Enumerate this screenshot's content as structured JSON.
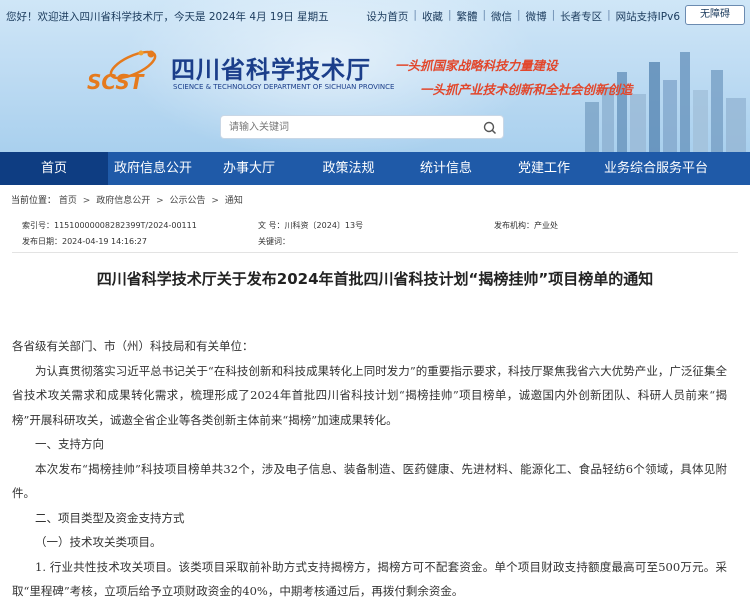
{
  "topbar": {
    "welcome": "您好！欢迎进入四川省科学技术厅，今天是  2024年 4月 19日  星期五",
    "links": [
      "设为首页",
      "收藏",
      "繁體",
      "微信",
      "微博",
      "长者专区",
      "网站支持IPv6"
    ],
    "accessible_button": "无障碍"
  },
  "logo": {
    "abbr": "SCST",
    "cn_name": "四川省科学技术厅",
    "en_name": "SCIENCE & TECHNOLOGY DEPARTMENT OF SICHUAN PROVINCE"
  },
  "slogans": [
    "一头抓国家战略科技力量建设",
    "一头抓产业技术创新和全社会创新创造"
  ],
  "search": {
    "placeholder": "请输入关键词"
  },
  "nav": {
    "items": [
      "首页",
      "政府信息公开",
      "办事大厅",
      "政策法规",
      "统计信息",
      "党建工作",
      "业务综合服务平台"
    ],
    "active_index": 0
  },
  "breadcrumb": {
    "label": "当前位置：",
    "items": [
      "首页",
      "政府信息公开",
      "公示公告",
      "通知"
    ]
  },
  "meta": {
    "index_label": "索引号：",
    "index_value": "11510000008282399T/2024-00111",
    "doc_label": "文    号：",
    "doc_value": "川科资〔2024〕13号",
    "issuer_label": "发布机构：",
    "issuer_value": "产业处",
    "date_label": "发布日期：",
    "date_value": "2024-04-19 14:16:27",
    "keywords_label": "关键词：",
    "keywords_value": ""
  },
  "article": {
    "title": "四川省科学技术厅关于发布2024年首批四川省科技计划“揭榜挂帅”项目榜单的通知",
    "salutation": "各省级有关部门、市（州）科技局和有关单位：",
    "para1": "为认真贯彻落实习近平总书记关于“在科技创新和科技成果转化上同时发力”的重要指示要求，科技厅聚焦我省六大优势产业，广泛征集全省技术攻关需求和成果转化需求，梳理形成了2024年首批四川省科技计划“揭榜挂帅”项目榜单，诚邀国内外创新团队、科研人员前来“揭榜”开展科研攻关，诚邀全省企业等各类创新主体前来“揭榜”加速成果转化。",
    "h1": "一、支持方向",
    "para2": "本次发布“揭榜挂帅”科技项目榜单共32个，涉及电子信息、装备制造、医药健康、先进材料、能源化工、食品轻纺6个领域，具体见附件。",
    "h2": "二、项目类型及资金支持方式",
    "sub1": "（一）技术攻关类项目。",
    "para3": "1. 行业共性技术攻关项目。该类项目采取前补助方式支持揭榜方，揭榜方可不配套资金。单个项目财政支持额度最高可至500万元。采取“里程碑”考核，立项后给予立项财政资金的40%，中期考核通过后，再拨付剩余资金。"
  },
  "colors": {
    "nav_bg": "#1f5aa8",
    "nav_active": "#0e3d82",
    "logo_blue": "#1b3e8a",
    "slogan_red": "#e2472c"
  }
}
